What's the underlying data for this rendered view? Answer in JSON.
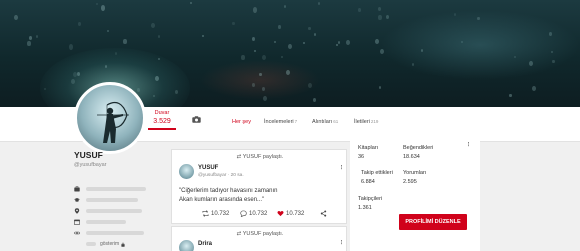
{
  "profile": {
    "name": "YUSUF",
    "handle": "@yusufbayar",
    "follow_label": "Duvar",
    "follow_count": "3.529",
    "visibility_text": "gösterim"
  },
  "tabs": [
    {
      "label": "Her şey",
      "count": ""
    },
    {
      "label": "İncelemeleri",
      "count": "7"
    },
    {
      "label": "Alıntıları",
      "count": "61"
    },
    {
      "label": "İletileri",
      "count": "219"
    }
  ],
  "post": {
    "shared_text": "YUSUF paylaştı.",
    "author": "YUSUF",
    "meta": "@yusufbayar · 20 sa.",
    "text_line1": "\"Ciğerlerim tadıyor havasını zamanın",
    "text_line2": "Akan kumların arasında esen...\"",
    "retweets": "10.732",
    "comments": "10.732",
    "likes": "10.732"
  },
  "post2": {
    "shared_text": "YUSUF paylaştı.",
    "author": "Drira"
  },
  "stats": {
    "kitaplari_label": "Kitapları",
    "kitaplari_value": "36",
    "begendikleri_label": "Beğendikleri",
    "begendikleri_value": "18.634",
    "takip_ettikleri_label": "Takip ettikleri",
    "takip_ettikleri_value": "6.884",
    "yorumlari_label": "Yorumları",
    "yorumlari_value": "2.595",
    "takipcileri_label": "Takipçileri",
    "takipcileri_value": "1.361"
  },
  "edit_button": "PROFİLİMİ DÜZENLE",
  "colors": {
    "accent": "#d0021b",
    "cover": "#14303a"
  },
  "icons": [
    "camera-icon",
    "retweet-icon",
    "comment-icon",
    "heart-icon",
    "share-icon",
    "more-icon",
    "briefcase-icon",
    "graduation-cap-icon",
    "location-icon",
    "calendar-icon",
    "link-icon",
    "lock-icon"
  ]
}
